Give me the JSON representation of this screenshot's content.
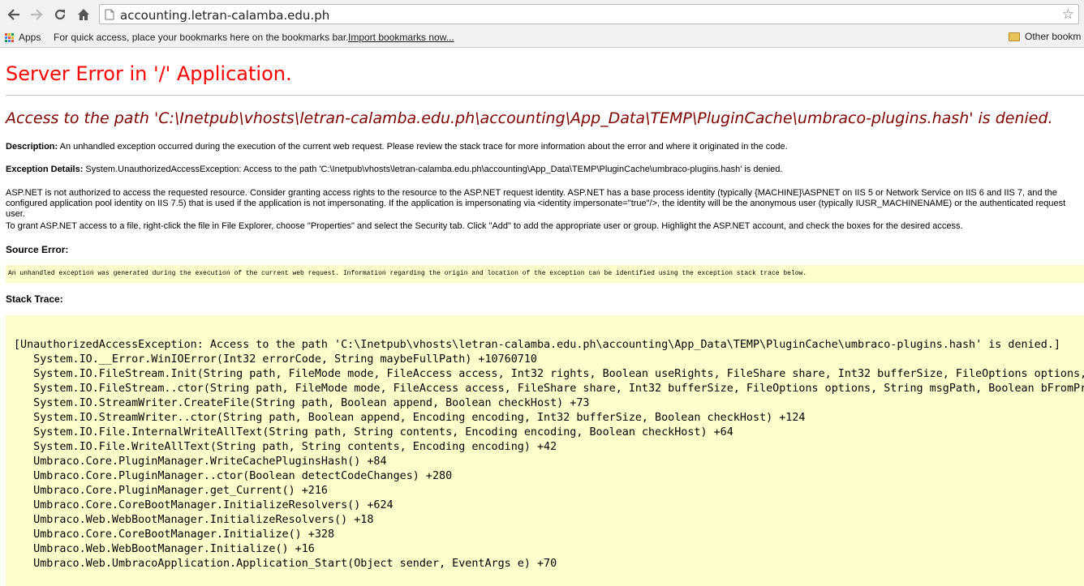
{
  "browser": {
    "url": "accounting.letran-calamba.edu.ph",
    "bookmarks": {
      "apps_label": "Apps",
      "hint": "For quick access, place your bookmarks here on the bookmarks bar.",
      "import_link": "Import bookmarks now...",
      "other_label": "Other bookm"
    }
  },
  "page": {
    "title": "Server Error in '/' Application.",
    "error_message": "Access to the path 'C:\\Inetpub\\vhosts\\letran-calamba.edu.ph\\accounting\\App_Data\\TEMP\\PluginCache\\umbraco-plugins.hash' is denied.",
    "description_label": "Description:",
    "description_text": "An unhandled exception occurred during the execution of the current web request. Please review the stack trace for more information about the error and where it originated in the code.",
    "exception_label": "Exception Details:",
    "exception_text": "System.UnauthorizedAccessException: Access to the path 'C:\\Inetpub\\vhosts\\letran-calamba.edu.ph\\accounting\\App_Data\\TEMP\\PluginCache\\umbraco-plugins.hash' is denied.",
    "aspnet_paragraph": "ASP.NET is not authorized to access the requested resource. Consider granting access rights to the resource to the ASP.NET request identity. ASP.NET has a base process identity (typically {MACHINE}\\ASPNET on IIS 5 or Network Service on IIS 6 and IIS 7, and the configured application pool identity on IIS 7.5) that is used if the application is not impersonating. If the application is impersonating via <identity impersonate=\"true\"/>, the identity will be the anonymous user (typically IUSR_MACHINENAME) or the authenticated request user.",
    "grant_paragraph": "To grant ASP.NET access to a file, right-click the file in File Explorer, choose \"Properties\" and select the Security tab. Click \"Add\" to add the appropriate user or group. Highlight the ASP.NET account, and check the boxes for the desired access.",
    "source_error_heading": "Source Error:",
    "source_error_text": "An unhandled exception was generated during the execution of the current web request. Information regarding the origin and location of the exception can be identified using the exception stack trace below.",
    "stack_trace_heading": "Stack Trace:",
    "stack_trace": [
      "[UnauthorizedAccessException: Access to the path 'C:\\Inetpub\\vhosts\\letran-calamba.edu.ph\\accounting\\App_Data\\TEMP\\PluginCache\\umbraco-plugins.hash' is denied.]",
      "   System.IO.__Error.WinIOError(Int32 errorCode, String maybeFullPath) +10760710",
      "   System.IO.FileStream.Init(String path, FileMode mode, FileAccess access, Int32 rights, Boolean useRights, FileShare share, Int32 bufferSize, FileOptions options,",
      "   System.IO.FileStream..ctor(String path, FileMode mode, FileAccess access, FileShare share, Int32 bufferSize, FileOptions options, String msgPath, Boolean bFromPro",
      "   System.IO.StreamWriter.CreateFile(String path, Boolean append, Boolean checkHost) +73",
      "   System.IO.StreamWriter..ctor(String path, Boolean append, Encoding encoding, Int32 bufferSize, Boolean checkHost) +124",
      "   System.IO.File.InternalWriteAllText(String path, String contents, Encoding encoding, Boolean checkHost) +64",
      "   System.IO.File.WriteAllText(String path, String contents, Encoding encoding) +42",
      "   Umbraco.Core.PluginManager.WriteCachePluginsHash() +84",
      "   Umbraco.Core.PluginManager..ctor(Boolean detectCodeChanges) +280",
      "   Umbraco.Core.PluginManager.get_Current() +216",
      "   Umbraco.Core.CoreBootManager.InitializeResolvers() +624",
      "   Umbraco.Web.WebBootManager.InitializeResolvers() +18",
      "   Umbraco.Core.CoreBootManager.Initialize() +328",
      "   Umbraco.Web.WebBootManager.Initialize() +16",
      "   Umbraco.Web.UmbracoApplication.Application_Start(Object sender, EventArgs e) +70"
    ]
  }
}
